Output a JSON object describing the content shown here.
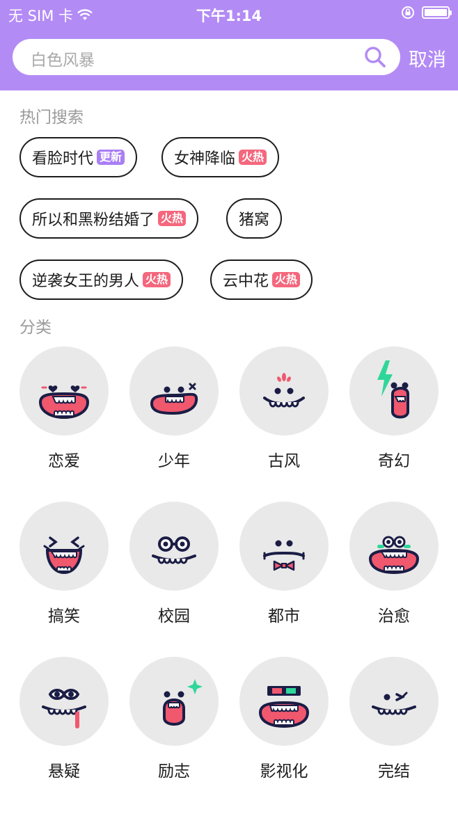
{
  "status_bar": {
    "carrier": "无 SIM 卡",
    "time": "下午1:14"
  },
  "search": {
    "placeholder": "白色风暴",
    "cancel_label": "取消"
  },
  "hot": {
    "title": "热门搜索",
    "tags": [
      {
        "text": "看脸时代",
        "badge": "更新",
        "badge_color": "#a97ef5"
      },
      {
        "text": "女神降临",
        "badge": "火热",
        "badge_color": "#f4677d"
      },
      {
        "text": "所以和黑粉结婚了",
        "badge": "火热",
        "badge_color": "#f4677d"
      },
      {
        "text": "猪窝",
        "badge": "",
        "badge_color": ""
      },
      {
        "text": "逆袭女王的男人",
        "badge": "火热",
        "badge_color": "#f4677d"
      },
      {
        "text": "云中花",
        "badge": "火热",
        "badge_color": "#f4677d"
      }
    ]
  },
  "categories": {
    "title": "分类",
    "items": [
      {
        "label": "恋爱",
        "icon": "love-face-icon"
      },
      {
        "label": "少年",
        "icon": "youth-face-icon"
      },
      {
        "label": "古风",
        "icon": "ancient-face-icon"
      },
      {
        "label": "奇幻",
        "icon": "fantasy-face-icon"
      },
      {
        "label": "搞笑",
        "icon": "funny-face-icon"
      },
      {
        "label": "校园",
        "icon": "campus-face-icon"
      },
      {
        "label": "都市",
        "icon": "city-face-icon"
      },
      {
        "label": "治愈",
        "icon": "healing-face-icon"
      },
      {
        "label": "悬疑",
        "icon": "suspense-face-icon"
      },
      {
        "label": "励志",
        "icon": "inspire-face-icon"
      },
      {
        "label": "影视化",
        "icon": "film-face-icon"
      },
      {
        "label": "完结",
        "icon": "finished-face-icon"
      }
    ]
  },
  "colors": {
    "brand": "#b38bf5",
    "mouth": "#f0586e",
    "ink": "#1b1d45",
    "circle": "#e9e9e9"
  }
}
